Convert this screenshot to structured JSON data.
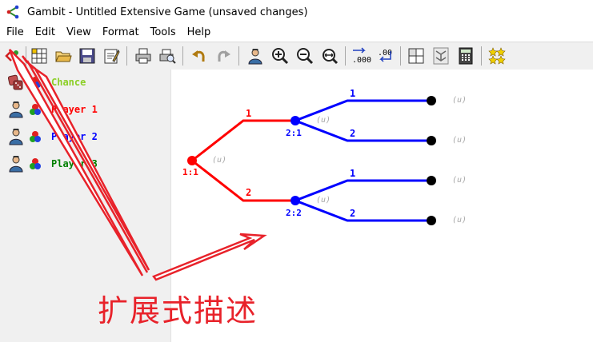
{
  "window": {
    "title": "Gambit - Untitled Extensive Game (unsaved changes)",
    "app_icon": "gambit-tree-icon"
  },
  "menu": [
    "File",
    "Edit",
    "View",
    "Format",
    "Tools",
    "Help"
  ],
  "toolbar": {
    "items": [
      "add-player-icon",
      "new-table-icon",
      "open-folder-icon",
      "save-icon",
      "edit-properties-icon",
      "print-icon",
      "print-preview-icon",
      "undo-icon",
      "redo-icon",
      "player-icon",
      "zoom-in-icon",
      "zoom-out-icon",
      "zoom-fit-icon",
      "decimal-format-icon",
      "fraction-format-icon",
      "strategic-view-icon",
      "tree-layout-icon",
      "calculator-icon",
      "equilibrium-icon"
    ],
    "decimals_glyph": ".000",
    "fractions_glyph": ".00"
  },
  "players": [
    {
      "name": "Chance",
      "color": "#8ccf27"
    },
    {
      "name": "Player 1",
      "color": "#ff0000"
    },
    {
      "name": "Player 2",
      "color": "#0000ff"
    },
    {
      "name": "Player 3",
      "color": "#008000"
    }
  ],
  "tree": {
    "root_label": "1:1",
    "root_payoff": "(u)",
    "branches": [
      {
        "action": "1",
        "node_label": "2:1",
        "node_payoff": "(u)",
        "children": [
          {
            "action": "1",
            "payoff": "(u)"
          },
          {
            "action": "2",
            "payoff": "(u)"
          }
        ]
      },
      {
        "action": "2",
        "node_label": "2:2",
        "node_payoff": "(u)",
        "children": [
          {
            "action": "1",
            "payoff": "(u)"
          },
          {
            "action": "2",
            "payoff": "(u)"
          }
        ]
      }
    ]
  },
  "annotation": {
    "text": "扩展式描述",
    "color": "#e8222a"
  }
}
